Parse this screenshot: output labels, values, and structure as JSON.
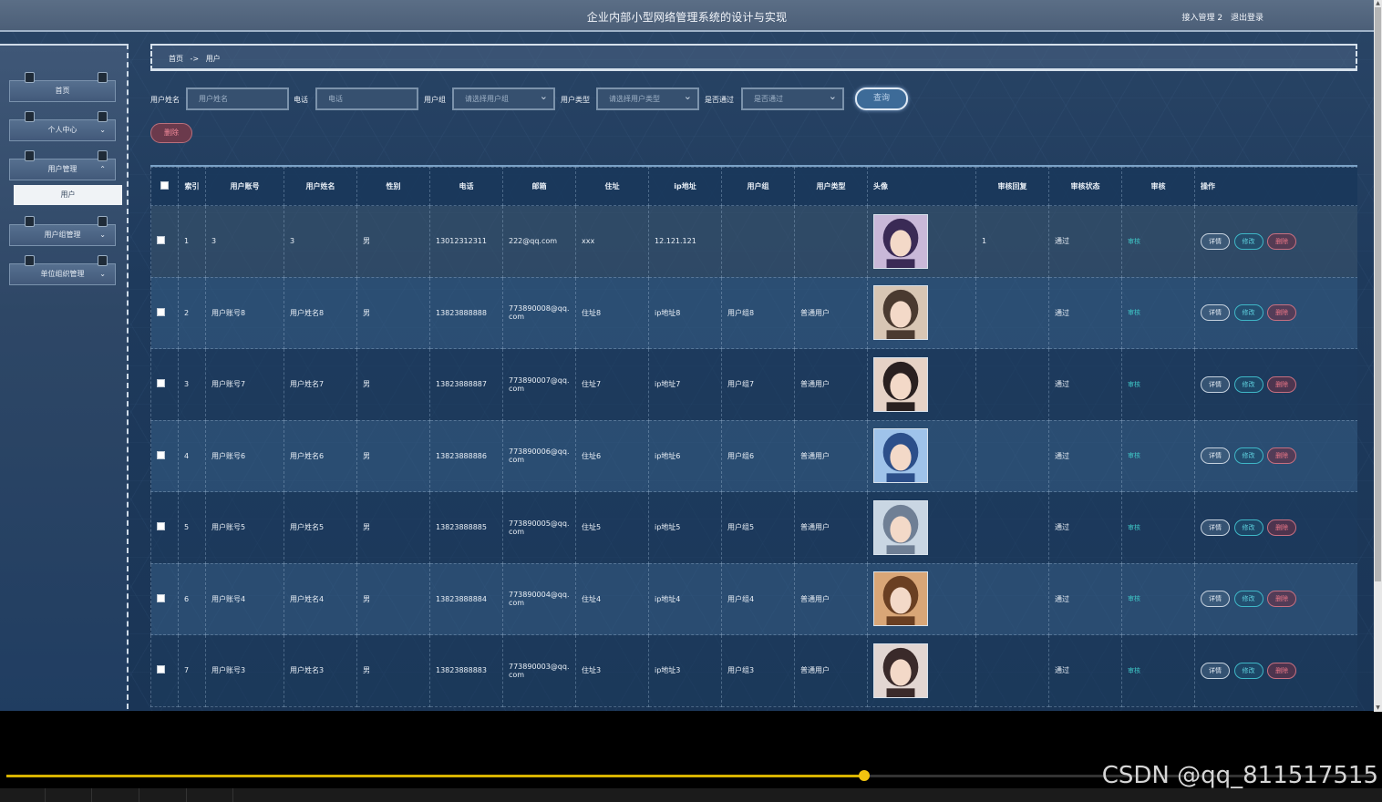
{
  "header": {
    "title": "企业内部小型网络管理系统的设计与实现",
    "user_text": "接入管理 2",
    "logout_label": "退出登录"
  },
  "sidebar": {
    "items": [
      {
        "label": "首页",
        "expandable": false
      },
      {
        "label": "个人中心",
        "expandable": true,
        "expanded": false
      },
      {
        "label": "用户管理",
        "expandable": true,
        "expanded": true
      },
      {
        "label": "用户组管理",
        "expandable": true,
        "expanded": false
      },
      {
        "label": "单位组织管理",
        "expandable": true,
        "expanded": false
      }
    ],
    "submenu_active": "用户"
  },
  "breadcrumb": {
    "home": "首页",
    "separator": "->",
    "current": "用户"
  },
  "filters": {
    "username_label": "用户姓名",
    "username_placeholder": "用户姓名",
    "phone_label": "电话",
    "phone_placeholder": "电话",
    "group_label": "用户组",
    "group_placeholder": "请选择用户组",
    "type_label": "用户类型",
    "type_placeholder": "请选择用户类型",
    "passed_label": "是否通过",
    "passed_placeholder": "是否通过",
    "query_label": "查询"
  },
  "bulk_delete_label": "删除",
  "table": {
    "columns": [
      "索引",
      "用户账号",
      "用户姓名",
      "性别",
      "电话",
      "邮箱",
      "住址",
      "ip地址",
      "用户组",
      "用户类型",
      "头像",
      "审核回复",
      "审核状态",
      "审核",
      "操作"
    ],
    "audit_link_label": "审核",
    "actions": {
      "detail": "详情",
      "edit": "修改",
      "delete": "删除"
    },
    "rows": [
      {
        "index": "1",
        "account": "3",
        "name": "3",
        "gender": "男",
        "phone": "13012312311",
        "email": "222@qq.com",
        "address": "xxx",
        "ip": "12.121.121",
        "group": "",
        "type": "",
        "reply": "1",
        "status": "通过"
      },
      {
        "index": "2",
        "account": "用户账号8",
        "name": "用户姓名8",
        "gender": "男",
        "phone": "13823888888",
        "email": "773890008@qq.com",
        "address": "住址8",
        "ip": "ip地址8",
        "group": "用户组8",
        "type": "普通用户",
        "reply": "",
        "status": "通过"
      },
      {
        "index": "3",
        "account": "用户账号7",
        "name": "用户姓名7",
        "gender": "男",
        "phone": "13823888887",
        "email": "773890007@qq.com",
        "address": "住址7",
        "ip": "ip地址7",
        "group": "用户组7",
        "type": "普通用户",
        "reply": "",
        "status": "通过"
      },
      {
        "index": "4",
        "account": "用户账号6",
        "name": "用户姓名6",
        "gender": "男",
        "phone": "13823888886",
        "email": "773890006@qq.com",
        "address": "住址6",
        "ip": "ip地址6",
        "group": "用户组6",
        "type": "普通用户",
        "reply": "",
        "status": "通过"
      },
      {
        "index": "5",
        "account": "用户账号5",
        "name": "用户姓名5",
        "gender": "男",
        "phone": "13823888885",
        "email": "773890005@qq.com",
        "address": "住址5",
        "ip": "ip地址5",
        "group": "用户组5",
        "type": "普通用户",
        "reply": "",
        "status": "通过"
      },
      {
        "index": "6",
        "account": "用户账号4",
        "name": "用户姓名4",
        "gender": "男",
        "phone": "13823888884",
        "email": "773890004@qq.com",
        "address": "住址4",
        "ip": "ip地址4",
        "group": "用户组4",
        "type": "普通用户",
        "reply": "",
        "status": "通过"
      },
      {
        "index": "7",
        "account": "用户账号3",
        "name": "用户姓名3",
        "gender": "男",
        "phone": "13823888883",
        "email": "773890003@qq.com",
        "address": "住址3",
        "ip": "ip地址3",
        "group": "用户组3",
        "type": "普通用户",
        "reply": "",
        "status": "通过"
      }
    ]
  },
  "avatar_colors": [
    [
      "#c9b8d8",
      "#3a2a55"
    ],
    [
      "#d8c6b4",
      "#4a3a30"
    ],
    [
      "#e6d2c6",
      "#2a2020"
    ],
    [
      "#9fc3ea",
      "#2c4f8a"
    ],
    [
      "#c9d6e3",
      "#6f7f95"
    ],
    [
      "#d9a677",
      "#6a3f22"
    ],
    [
      "#e2d6d2",
      "#3a2a2a"
    ]
  ],
  "player": {
    "progress": 0.627,
    "watermark": "CSDN @qq_811517515"
  }
}
